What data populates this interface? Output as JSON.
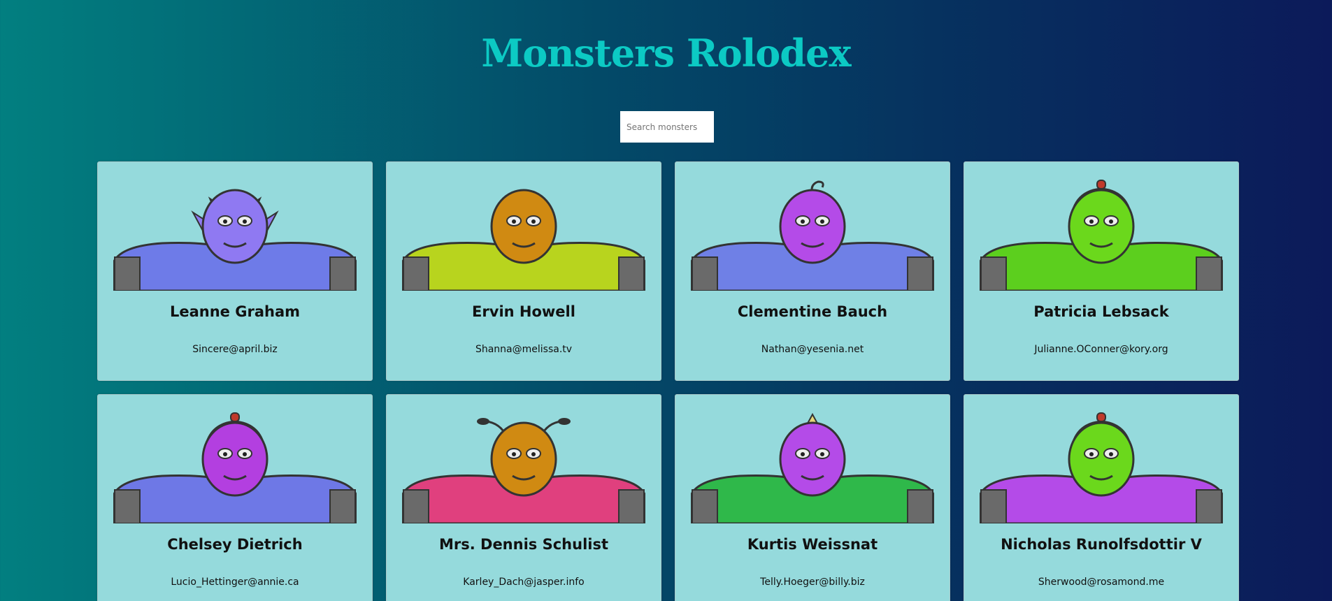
{
  "app": {
    "title": "Monsters Rolodex"
  },
  "search": {
    "placeholder": "Search monsters",
    "value": ""
  },
  "monsters": [
    {
      "name": "Leanne Graham",
      "email": "Sincere@april.biz",
      "icon": "horned-monster-avatar",
      "skin": "#8f79f2",
      "body": "#6e7be8",
      "accent": "#e6d77a"
    },
    {
      "name": "Ervin Howell",
      "email": "Shanna@melissa.tv",
      "icon": "orange-monster-avatar",
      "skin": "#d08a12",
      "body": "#b8d41e",
      "accent": "#8a6a10"
    },
    {
      "name": "Clementine Bauch",
      "email": "Nathan@yesenia.net",
      "icon": "cyclops-robot-avatar",
      "skin": "#b44be8",
      "body": "#6f80e6",
      "accent": "#d9d9d9"
    },
    {
      "name": "Patricia Lebsack",
      "email": "Julianne.OConner@kory.org",
      "icon": "helmet-monster-avatar",
      "skin": "#6bd81c",
      "body": "#5ccf1e",
      "accent": "#7a7a7a"
    },
    {
      "name": "Chelsey Dietrich",
      "email": "Lucio_Hettinger@annie.ca",
      "icon": "visor-robot-avatar",
      "skin": "#b33fe0",
      "body": "#6e78e6",
      "accent": "#7a7a7a"
    },
    {
      "name": "Mrs. Dennis Schulist",
      "email": "Karley_Dach@jasper.info",
      "icon": "antenna-monster-avatar",
      "skin": "#d08a12",
      "body": "#e0407e",
      "accent": "#555555"
    },
    {
      "name": "Kurtis Weissnat",
      "email": "Telly.Hoeger@billy.biz",
      "icon": "crested-monster-avatar",
      "skin": "#b44be8",
      "body": "#2fb84a",
      "accent": "#e6d77a"
    },
    {
      "name": "Nicholas Runolfsdottir V",
      "email": "Sherwood@rosamond.me",
      "icon": "bolted-robot-avatar",
      "skin": "#6bd81c",
      "body": "#b44be8",
      "accent": "#7a7a7a"
    }
  ]
}
